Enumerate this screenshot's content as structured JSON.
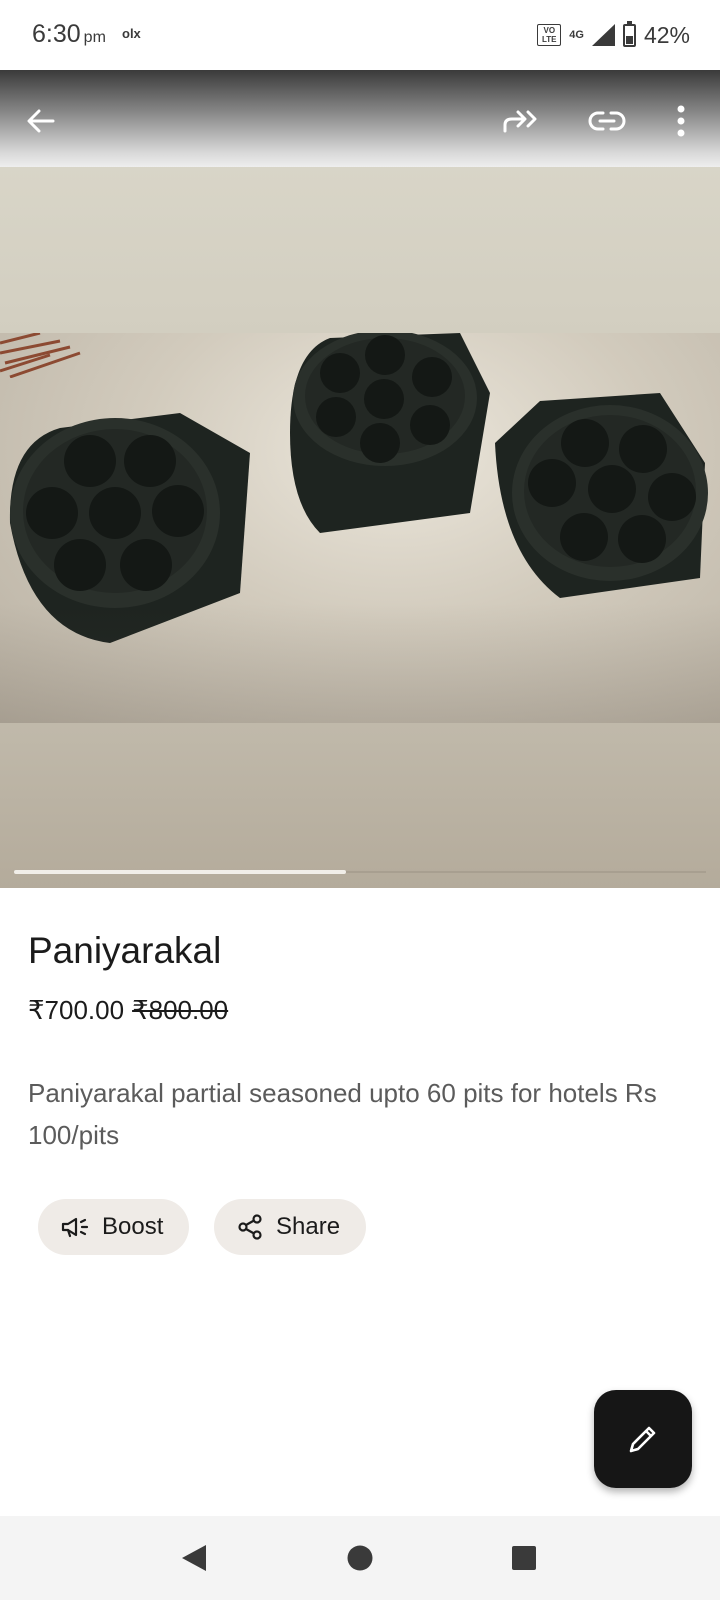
{
  "status_bar": {
    "time": "6:30",
    "ampm": "pm",
    "app_indicator": "olx",
    "volte_label": "VO LTE",
    "network": "4G",
    "battery_percent": "42%",
    "battery_level": 0.42,
    "icons": [
      "volte-icon",
      "network-4g-icon",
      "signal-icon",
      "battery-icon"
    ]
  },
  "toolbar": {
    "icons": [
      "back-arrow-icon",
      "forward-share-icon",
      "link-icon",
      "more-vert-icon"
    ]
  },
  "gallery": {
    "image_alt": "",
    "progress_fraction": 0.48
  },
  "listing": {
    "title": "Paniyarakal",
    "price": "₹700.00",
    "original_price": "₹800.00",
    "description": "Paniyarakal partial seasoned upto 60 pits for hotels Rs 100/pits"
  },
  "actions": {
    "boost_label": "Boost",
    "share_label": "Share"
  },
  "fab": {
    "icon": "edit-pencil-icon"
  },
  "nav": {
    "icons": [
      "back-triangle-icon",
      "home-circle-icon",
      "recents-square-icon"
    ]
  },
  "colors": {
    "chip_bg": "#efebe7",
    "fab_bg": "#161616",
    "nav_bg": "#f4f4f4"
  }
}
